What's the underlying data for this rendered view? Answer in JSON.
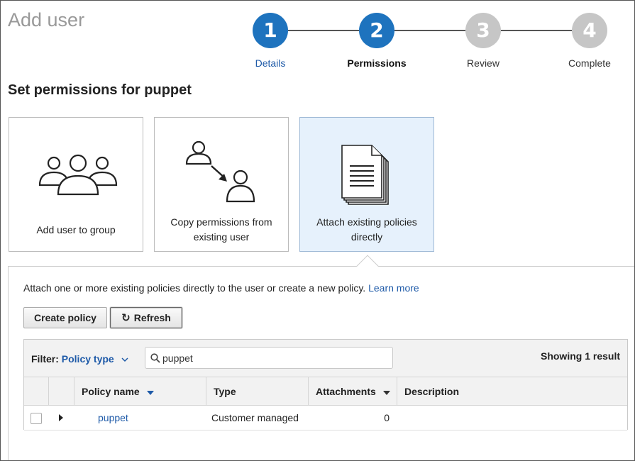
{
  "page": {
    "title": "Add user"
  },
  "steps": [
    {
      "number": "1",
      "label": "Details",
      "state": "done"
    },
    {
      "number": "2",
      "label": "Permissions",
      "state": "current"
    },
    {
      "number": "3",
      "label": "Review",
      "state": "future"
    },
    {
      "number": "4",
      "label": "Complete",
      "state": "future"
    }
  ],
  "section_title": "Set permissions for puppet",
  "options": [
    {
      "label": "Add user to group",
      "icon": "user-group-icon",
      "selected": false
    },
    {
      "label_line1": "Copy permissions from",
      "label_line2": "existing user",
      "icon": "copy-user-icon",
      "selected": false
    },
    {
      "label_line1": "Attach existing policies",
      "label_line2": "directly",
      "icon": "policy-document-icon",
      "selected": true
    }
  ],
  "panel": {
    "description": "Attach one or more existing policies directly to the user or create a new policy.",
    "learn_more": "Learn more",
    "create_policy_label": "Create policy",
    "refresh_label": "Refresh"
  },
  "filter": {
    "label": "Filter:",
    "value": "Policy type",
    "search_value": "puppet",
    "showing": "Showing 1 result"
  },
  "table": {
    "columns": [
      "Policy name",
      "Type",
      "Attachments",
      "Description"
    ],
    "rows": [
      {
        "name": "puppet",
        "type": "Customer managed",
        "attachments": "0",
        "description": ""
      }
    ]
  },
  "colors": {
    "accent": "#1e73be",
    "link": "#1e5aa8",
    "inactive_step": "#c6c6c6",
    "selected_card": "#e6f1fc"
  }
}
